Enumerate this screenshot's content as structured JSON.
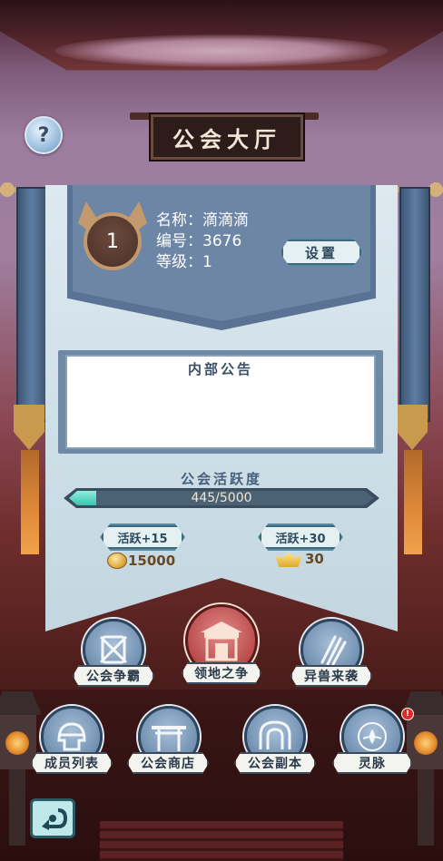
{
  "header": {
    "title": "公会大厅",
    "help_label": "?"
  },
  "guild": {
    "level_badge": "1",
    "name_line": "名称：滴滴滴",
    "id_line": "编号：3676",
    "grade_line": "等级：1",
    "settings_label": "设置"
  },
  "notice": {
    "title": "内部公告",
    "body": ""
  },
  "activity": {
    "title": "公会活跃度",
    "progress_text": "445/5000",
    "current": 445,
    "max": 5000,
    "rewards": [
      {
        "tag": "活跃+15",
        "amount": "15000",
        "icon": "gold-coin-icon"
      },
      {
        "tag": "活跃+30",
        "amount": "30",
        "icon": "gold-ingot-icon"
      }
    ]
  },
  "feature_buttons": [
    {
      "label": "公会争霸",
      "icon": "crossed-swords-shield-icon"
    },
    {
      "label": "领地之争",
      "icon": "palace-gate-icon"
    },
    {
      "label": "异兽来袭",
      "icon": "claw-marks-icon"
    }
  ],
  "bottom_buttons": [
    {
      "label": "成员列表",
      "icon": "helmet-icon"
    },
    {
      "label": "公会商店",
      "icon": "shop-gate-icon"
    },
    {
      "label": "公会副本",
      "icon": "dungeon-door-icon"
    },
    {
      "label": "灵脉",
      "icon": "spirit-vein-icon",
      "alert": "!"
    }
  ],
  "back_icon": "return-arrow-icon",
  "colors": {
    "panel": "#cddee7",
    "accent": "#5a7394",
    "bar_fill": "#3cc4b0",
    "alert": "#e02828"
  }
}
